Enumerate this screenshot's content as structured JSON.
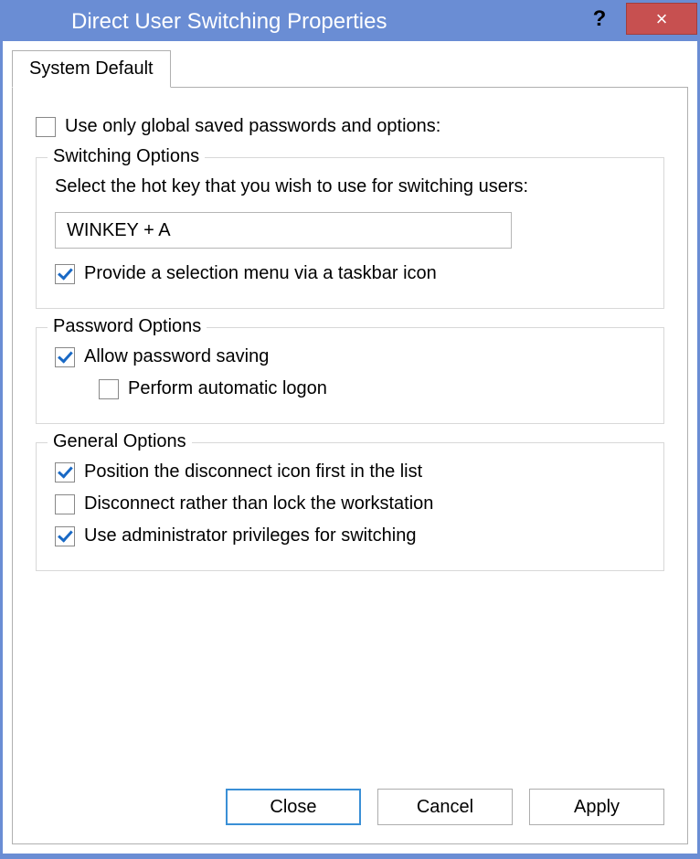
{
  "titlebar": {
    "title": "Direct User Switching Properties",
    "help_symbol": "?",
    "close_symbol": "×"
  },
  "tabs": {
    "system_default": "System Default"
  },
  "top_option": {
    "label": "Use only global saved passwords and options:",
    "checked": false
  },
  "switching_options": {
    "legend": "Switching Options",
    "instruction": "Select the hot key that you wish to use for switching users:",
    "hotkey_value": "WINKEY + A",
    "taskbar_label": "Provide a selection menu via a taskbar icon",
    "taskbar_checked": true
  },
  "password_options": {
    "legend": "Password Options",
    "allow_label": "Allow password saving",
    "allow_checked": true,
    "auto_label": "Perform automatic logon",
    "auto_checked": false
  },
  "general_options": {
    "legend": "General Options",
    "position_label": "Position the disconnect icon first in the list",
    "position_checked": true,
    "disconnect_label": "Disconnect rather than lock the workstation",
    "disconnect_checked": false,
    "admin_label": "Use administrator privileges for switching",
    "admin_checked": true
  },
  "buttons": {
    "close": "Close",
    "cancel": "Cancel",
    "apply": "Apply"
  }
}
